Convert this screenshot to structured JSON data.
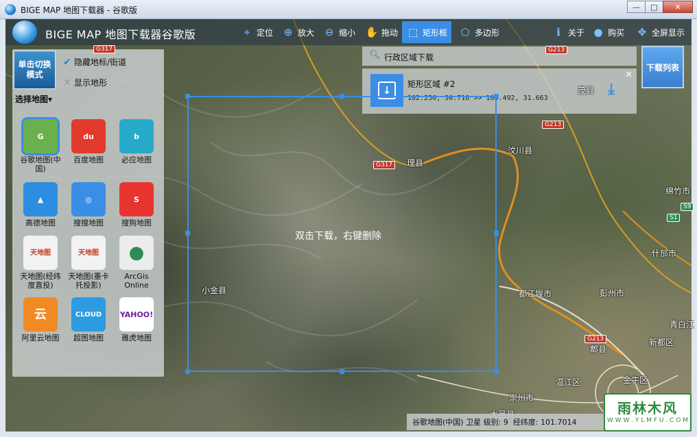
{
  "window": {
    "title": "BIGE MAP 地图下载器 - 谷歌版",
    "buttons": [
      "—",
      "□",
      "✕"
    ]
  },
  "toolbar": {
    "app_name": "BIGE MAP 地图下载器谷歌版",
    "tools": [
      {
        "label": "定位",
        "icon": "locate-icon"
      },
      {
        "label": "放大",
        "icon": "zoom-in-icon"
      },
      {
        "label": "缩小",
        "icon": "zoom-out-icon"
      },
      {
        "label": "拖动",
        "icon": "hand-icon"
      },
      {
        "label": "矩形框",
        "icon": "rectangle-icon"
      },
      {
        "label": "多边形",
        "icon": "polygon-icon"
      },
      {
        "label": "关于",
        "icon": "info-icon"
      },
      {
        "label": "购买",
        "icon": "cart-icon"
      },
      {
        "label": "全屏显示",
        "icon": "fullscreen-icon"
      }
    ]
  },
  "left_panel": {
    "switch_mode": "单击切换模式",
    "select_map": "选择地图",
    "options": [
      {
        "label": "隐藏地标/街道",
        "checked": true
      },
      {
        "label": "显示地形",
        "checked": false
      }
    ],
    "maps": [
      {
        "label": "谷歌地图(中国)",
        "tile": "G",
        "color": "#6ab04c",
        "selected": true
      },
      {
        "label": "百度地图",
        "tile": "du",
        "color": "#e23b2e",
        "selected": false
      },
      {
        "label": "必应地图",
        "tile": "b",
        "color": "#27a9c9",
        "selected": false
      },
      {
        "label": "高德地图",
        "tile": "▲",
        "color": "#2d8de0",
        "selected": false
      },
      {
        "label": "搜搜地图",
        "tile": "◎",
        "color": "#3a8ee6",
        "selected": false
      },
      {
        "label": "搜狗地图",
        "tile": "S",
        "color": "#e8342f",
        "selected": false
      },
      {
        "label": "天地图(经纬度直投)",
        "tile": "天地图",
        "color": "#f2f2f2",
        "selected": false
      },
      {
        "label": "天地图(墨卡托投影)",
        "tile": "天地图",
        "color": "#f2f2f2",
        "selected": false
      },
      {
        "label": "ArcGis Online",
        "tile": "●",
        "color": "#ececec",
        "selected": false
      },
      {
        "label": "阿里云地图",
        "tile": "云",
        "color": "#f08a24",
        "selected": false
      },
      {
        "label": "超图地图",
        "tile": "CLOUD",
        "color": "#2d9be0",
        "selected": false
      },
      {
        "label": "雅虎地图",
        "tile": "YAHOO!",
        "color": "#ffffff",
        "selected": false
      }
    ]
  },
  "region_search": {
    "label": "行政区域下载"
  },
  "rect_task": {
    "name": "矩形区域 #2",
    "coords": "102.256, 30.716 >> 103.492, 31.663"
  },
  "download_list_button": "下载列表",
  "selection_hint": "双击下载，右键删除",
  "places": [
    {
      "name": "理县",
      "kind": "town"
    },
    {
      "name": "汶川县",
      "kind": "town"
    },
    {
      "name": "茂县",
      "kind": "town"
    },
    {
      "name": "小金县",
      "kind": "town"
    },
    {
      "name": "都江堰市",
      "kind": "town"
    },
    {
      "name": "彭州市",
      "kind": "town"
    },
    {
      "name": "什邡市",
      "kind": "town"
    },
    {
      "name": "绵竹市",
      "kind": "town"
    },
    {
      "name": "新都区",
      "kind": "town"
    },
    {
      "name": "郫县",
      "kind": "town"
    },
    {
      "name": "温江区",
      "kind": "town"
    },
    {
      "name": "金牛区",
      "kind": "town"
    },
    {
      "name": "崇州市",
      "kind": "town"
    },
    {
      "name": "青白江",
      "kind": "town"
    },
    {
      "name": "大邑县",
      "kind": "town"
    }
  ],
  "roads": [
    "G317",
    "G213",
    "S1",
    "S9"
  ],
  "status": {
    "map": "谷歌地图(中国) 卫星",
    "level_label": "级别:",
    "level": "9",
    "coord_label": "经纬度:",
    "coord": "101.7014"
  },
  "watermark": {
    "line1": "雨林木风",
    "line2": "W W W . Y L M F U . C O M"
  },
  "colors": {
    "accent": "#3a8ee6",
    "toolbar_bg": "#283746",
    "road_red": "#c0392b"
  }
}
